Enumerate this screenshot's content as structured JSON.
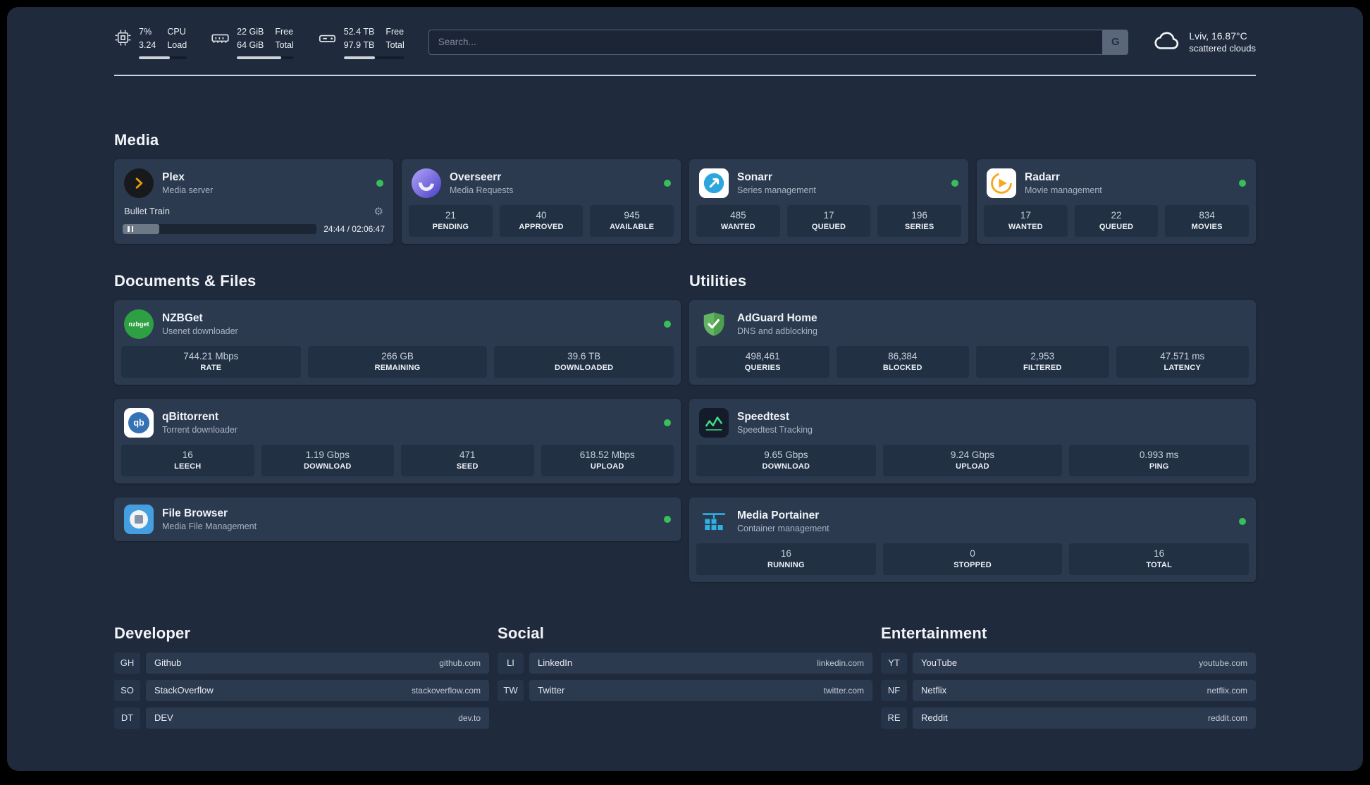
{
  "colors": {
    "status_online": "#37c058",
    "background": "#1f2a3c",
    "card": "#2c3a50",
    "accent_green": "#3ddc84"
  },
  "glyphs": {
    "gear": "⚙"
  },
  "topbar": {
    "cpu": {
      "values": [
        "7%",
        "3.24"
      ],
      "labels": [
        "CPU",
        "Load"
      ],
      "bar_percent": 65
    },
    "ram": {
      "values": [
        "22 GiB",
        "64 GiB"
      ],
      "labels": [
        "Free",
        "Total"
      ],
      "bar_percent": 78
    },
    "disk": {
      "values": [
        "52.4 TB",
        "97.9 TB"
      ],
      "labels": [
        "Free",
        "Total"
      ],
      "bar_percent": 52
    },
    "search": {
      "placeholder": "Search...",
      "engine_label": "G"
    },
    "weather": {
      "location": "Lviv, 16.87°C",
      "condition": "scattered clouds"
    }
  },
  "media": {
    "title": "Media",
    "plex": {
      "name": "Plex",
      "subtitle": "Media server",
      "now_playing": "Bullet Train",
      "time": "24:44 / 02:06:47",
      "progress_percent": 19
    },
    "overseerr": {
      "name": "Overseerr",
      "subtitle": "Media Requests",
      "stats": [
        {
          "value": "21",
          "label": "PENDING"
        },
        {
          "value": "40",
          "label": "APPROVED"
        },
        {
          "value": "945",
          "label": "AVAILABLE"
        }
      ]
    },
    "sonarr": {
      "name": "Sonarr",
      "subtitle": "Series management",
      "stats": [
        {
          "value": "485",
          "label": "WANTED"
        },
        {
          "value": "17",
          "label": "QUEUED"
        },
        {
          "value": "196",
          "label": "SERIES"
        }
      ]
    },
    "radarr": {
      "name": "Radarr",
      "subtitle": "Movie management",
      "stats": [
        {
          "value": "17",
          "label": "WANTED"
        },
        {
          "value": "22",
          "label": "QUEUED"
        },
        {
          "value": "834",
          "label": "MOVIES"
        }
      ]
    }
  },
  "files": {
    "title": "Documents & Files",
    "nzbget": {
      "name": "NZBGet",
      "subtitle": "Usenet downloader",
      "icon_text": "nzbget",
      "stats": [
        {
          "value": "744.21 Mbps",
          "label": "RATE"
        },
        {
          "value": "266 GB",
          "label": "REMAINING"
        },
        {
          "value": "39.6 TB",
          "label": "DOWNLOADED"
        }
      ]
    },
    "qbittorrent": {
      "name": "qBittorrent",
      "subtitle": "Torrent downloader",
      "icon_text": "qb",
      "stats": [
        {
          "value": "16",
          "label": "LEECH"
        },
        {
          "value": "1.19 Gbps",
          "label": "DOWNLOAD"
        },
        {
          "value": "471",
          "label": "SEED"
        },
        {
          "value": "618.52 Mbps",
          "label": "UPLOAD"
        }
      ]
    },
    "filebrowser": {
      "name": "File Browser",
      "subtitle": "Media File Management"
    }
  },
  "utilities": {
    "title": "Utilities",
    "adguard": {
      "name": "AdGuard Home",
      "subtitle": "DNS and adblocking",
      "stats": [
        {
          "value": "498,461",
          "label": "QUERIES"
        },
        {
          "value": "86,384",
          "label": "BLOCKED"
        },
        {
          "value": "2,953",
          "label": "FILTERED"
        },
        {
          "value": "47.571 ms",
          "label": "LATENCY"
        }
      ]
    },
    "speedtest": {
      "name": "Speedtest",
      "subtitle": "Speedtest Tracking",
      "stats": [
        {
          "value": "9.65 Gbps",
          "label": "DOWNLOAD"
        },
        {
          "value": "9.24 Gbps",
          "label": "UPLOAD"
        },
        {
          "value": "0.993 ms",
          "label": "PING"
        }
      ]
    },
    "portainer": {
      "name": "Media Portainer",
      "subtitle": "Container management",
      "stats": [
        {
          "value": "16",
          "label": "RUNNING"
        },
        {
          "value": "0",
          "label": "STOPPED"
        },
        {
          "value": "16",
          "label": "TOTAL"
        }
      ]
    }
  },
  "bookmarks": {
    "developer": {
      "title": "Developer",
      "links": [
        {
          "abbr": "GH",
          "name": "Github",
          "url": "github.com"
        },
        {
          "abbr": "SO",
          "name": "StackOverflow",
          "url": "stackoverflow.com"
        },
        {
          "abbr": "DT",
          "name": "DEV",
          "url": "dev.to"
        }
      ]
    },
    "social": {
      "title": "Social",
      "links": [
        {
          "abbr": "LI",
          "name": "LinkedIn",
          "url": "linkedin.com"
        },
        {
          "abbr": "TW",
          "name": "Twitter",
          "url": "twitter.com"
        }
      ]
    },
    "entertainment": {
      "title": "Entertainment",
      "links": [
        {
          "abbr": "YT",
          "name": "YouTube",
          "url": "youtube.com"
        },
        {
          "abbr": "NF",
          "name": "Netflix",
          "url": "netflix.com"
        },
        {
          "abbr": "RE",
          "name": "Reddit",
          "url": "reddit.com"
        }
      ]
    }
  }
}
